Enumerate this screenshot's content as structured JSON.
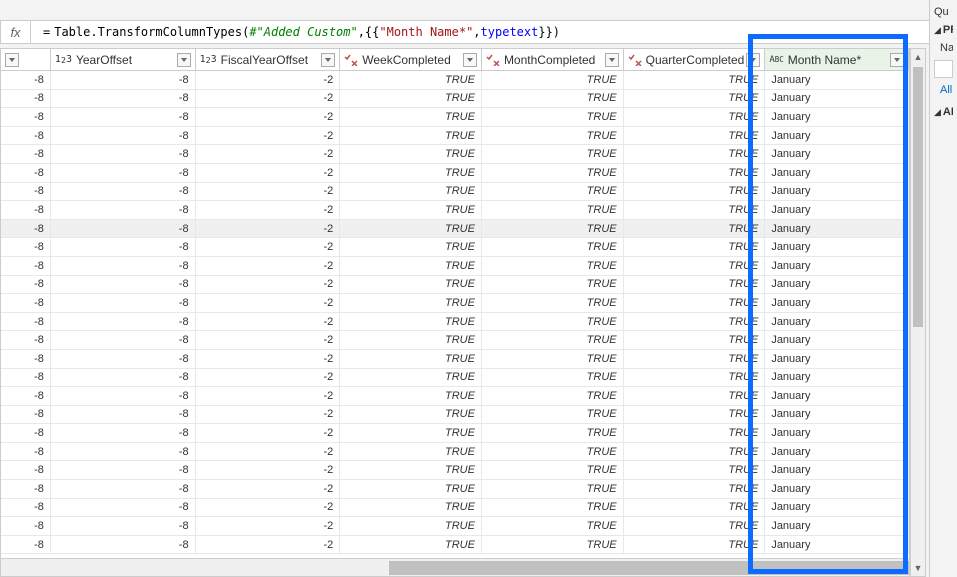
{
  "formula": {
    "prefix": "= ",
    "fn1": "Table.TransformColumnTypes(",
    "id": "#\"Added Custom\"",
    "mid": ",{{",
    "str": "\"Month Name*\"",
    "mid2": ", ",
    "kw1": "type",
    "sp": " ",
    "kw2": "text",
    "end": "}})"
  },
  "columns": [
    {
      "name": "YearOffset",
      "type": "int",
      "selected": false
    },
    {
      "name": "FiscalYearOffset",
      "type": "int",
      "selected": false
    },
    {
      "name": "WeekCompleted",
      "type": "tf",
      "selected": false
    },
    {
      "name": "MonthCompleted",
      "type": "tf",
      "selected": false
    },
    {
      "name": "QuarterCompleted",
      "type": "tf",
      "selected": false
    },
    {
      "name": "Month Name*",
      "type": "abc",
      "selected": true
    }
  ],
  "rows": [
    {
      "c0": "-8",
      "c1": "-8",
      "c2": "-2",
      "c3": "TRUE",
      "c4": "TRUE",
      "c5": "TRUE",
      "c6": "January"
    },
    {
      "c0": "-8",
      "c1": "-8",
      "c2": "-2",
      "c3": "TRUE",
      "c4": "TRUE",
      "c5": "TRUE",
      "c6": "January"
    },
    {
      "c0": "-8",
      "c1": "-8",
      "c2": "-2",
      "c3": "TRUE",
      "c4": "TRUE",
      "c5": "TRUE",
      "c6": "January"
    },
    {
      "c0": "-8",
      "c1": "-8",
      "c2": "-2",
      "c3": "TRUE",
      "c4": "TRUE",
      "c5": "TRUE",
      "c6": "January"
    },
    {
      "c0": "-8",
      "c1": "-8",
      "c2": "-2",
      "c3": "TRUE",
      "c4": "TRUE",
      "c5": "TRUE",
      "c6": "January"
    },
    {
      "c0": "-8",
      "c1": "-8",
      "c2": "-2",
      "c3": "TRUE",
      "c4": "TRUE",
      "c5": "TRUE",
      "c6": "January"
    },
    {
      "c0": "-8",
      "c1": "-8",
      "c2": "-2",
      "c3": "TRUE",
      "c4": "TRUE",
      "c5": "TRUE",
      "c6": "January"
    },
    {
      "c0": "-8",
      "c1": "-8",
      "c2": "-2",
      "c3": "TRUE",
      "c4": "TRUE",
      "c5": "TRUE",
      "c6": "January"
    },
    {
      "c0": "-8",
      "c1": "-8",
      "c2": "-2",
      "c3": "TRUE",
      "c4": "TRUE",
      "c5": "TRUE",
      "c6": "January",
      "hover": true
    },
    {
      "c0": "-8",
      "c1": "-8",
      "c2": "-2",
      "c3": "TRUE",
      "c4": "TRUE",
      "c5": "TRUE",
      "c6": "January"
    },
    {
      "c0": "-8",
      "c1": "-8",
      "c2": "-2",
      "c3": "TRUE",
      "c4": "TRUE",
      "c5": "TRUE",
      "c6": "January"
    },
    {
      "c0": "-8",
      "c1": "-8",
      "c2": "-2",
      "c3": "TRUE",
      "c4": "TRUE",
      "c5": "TRUE",
      "c6": "January"
    },
    {
      "c0": "-8",
      "c1": "-8",
      "c2": "-2",
      "c3": "TRUE",
      "c4": "TRUE",
      "c5": "TRUE",
      "c6": "January"
    },
    {
      "c0": "-8",
      "c1": "-8",
      "c2": "-2",
      "c3": "TRUE",
      "c4": "TRUE",
      "c5": "TRUE",
      "c6": "January"
    },
    {
      "c0": "-8",
      "c1": "-8",
      "c2": "-2",
      "c3": "TRUE",
      "c4": "TRUE",
      "c5": "TRUE",
      "c6": "January"
    },
    {
      "c0": "-8",
      "c1": "-8",
      "c2": "-2",
      "c3": "TRUE",
      "c4": "TRUE",
      "c5": "TRUE",
      "c6": "January"
    },
    {
      "c0": "-8",
      "c1": "-8",
      "c2": "-2",
      "c3": "TRUE",
      "c4": "TRUE",
      "c5": "TRUE",
      "c6": "January"
    },
    {
      "c0": "-8",
      "c1": "-8",
      "c2": "-2",
      "c3": "TRUE",
      "c4": "TRUE",
      "c5": "TRUE",
      "c6": "January"
    },
    {
      "c0": "-8",
      "c1": "-8",
      "c2": "-2",
      "c3": "TRUE",
      "c4": "TRUE",
      "c5": "TRUE",
      "c6": "January"
    },
    {
      "c0": "-8",
      "c1": "-8",
      "c2": "-2",
      "c3": "TRUE",
      "c4": "TRUE",
      "c5": "TRUE",
      "c6": "January"
    },
    {
      "c0": "-8",
      "c1": "-8",
      "c2": "-2",
      "c3": "TRUE",
      "c4": "TRUE",
      "c5": "TRUE",
      "c6": "January"
    },
    {
      "c0": "-8",
      "c1": "-8",
      "c2": "-2",
      "c3": "TRUE",
      "c4": "TRUE",
      "c5": "TRUE",
      "c6": "January"
    },
    {
      "c0": "-8",
      "c1": "-8",
      "c2": "-2",
      "c3": "TRUE",
      "c4": "TRUE",
      "c5": "TRUE",
      "c6": "January"
    },
    {
      "c0": "-8",
      "c1": "-8",
      "c2": "-2",
      "c3": "TRUE",
      "c4": "TRUE",
      "c5": "TRUE",
      "c6": "January"
    },
    {
      "c0": "-8",
      "c1": "-8",
      "c2": "-2",
      "c3": "TRUE",
      "c4": "TRUE",
      "c5": "TRUE",
      "c6": "January"
    },
    {
      "c0": "-8",
      "c1": "-8",
      "c2": "-2",
      "c3": "TRUE",
      "c4": "TRUE",
      "c5": "TRUE",
      "c6": "January"
    }
  ],
  "rightPanel": {
    "queries": "Qu",
    "properties": "PR",
    "name": "Na",
    "all": "All",
    "applied": "AP"
  }
}
